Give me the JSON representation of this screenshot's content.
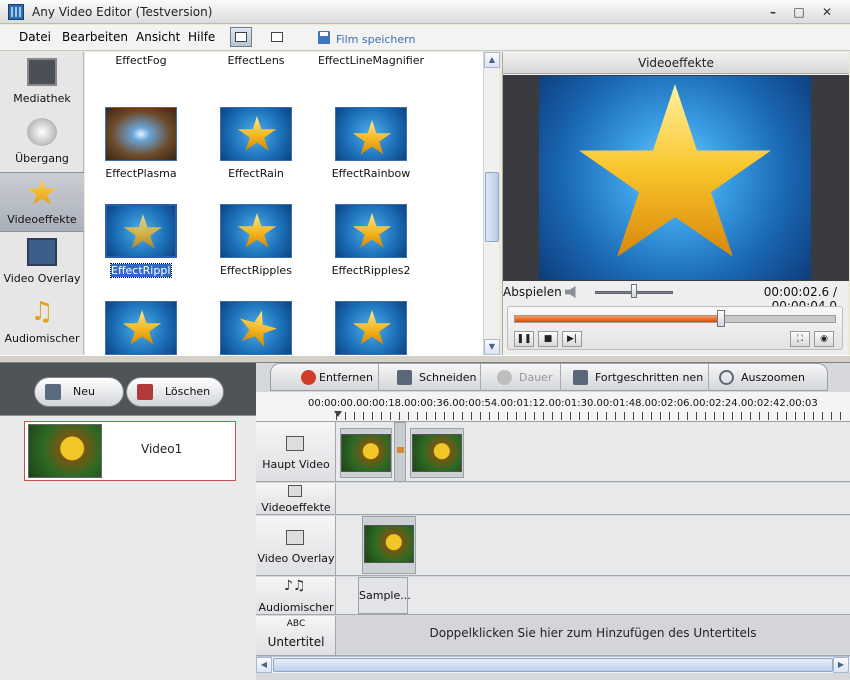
{
  "window": {
    "title": "Any Video Editor (Testversion)"
  },
  "menu": {
    "items": [
      "Datei",
      "Bearbeiten",
      "Ansicht",
      "Hilfe"
    ],
    "save_label": "Film speichern"
  },
  "categories": [
    {
      "label": "Mediathek",
      "icon": "film-icon"
    },
    {
      "label": "Übergang",
      "icon": "transition-icon"
    },
    {
      "label": "Videoeffekte",
      "icon": "effects-star-icon",
      "active": true
    },
    {
      "label": "Video Overlay",
      "icon": "overlay-icon"
    },
    {
      "label": "Audiomischer",
      "icon": "music-note-icon"
    }
  ],
  "effects": {
    "top_row": [
      "EffectFog",
      "EffectLens",
      "EffectLineMagnifier"
    ],
    "rows": [
      [
        "EffectPlasma",
        "EffectRain",
        "EffectRainbow"
      ],
      [
        "EffectRipple",
        "EffectRipples",
        "EffectRipples2"
      ]
    ],
    "selected": "EffectRipple"
  },
  "preview": {
    "title": "Videoeffekte",
    "play_label": "Abspielen",
    "time": "00:00:02.6 / 00:00:04.0",
    "progress_fraction": 0.65,
    "volume_fraction": 0.5
  },
  "media": {
    "new_label": "Neu",
    "delete_label": "Löschen",
    "items": [
      {
        "label": "Video1"
      }
    ]
  },
  "timeline": {
    "toolbar": {
      "remove": "Entfernen",
      "cut": "Schneiden",
      "duration": "Dauer",
      "advanced": "Fortgeschritten",
      "advanced_tail": "nen",
      "zoom_out": "Auszoomen"
    },
    "ruler": "00:00:00.00:00:18.00:00:36.00:00:54.00:01:12.00:01:30.00:01:48.00:02:06.00:02:24.00:02:42.00:03",
    "tracks": {
      "main_video": "Haupt Video",
      "video_effects": "Videoeffekte",
      "video_overlay": "Video Overlay",
      "audio_mixer": "Audiomischer",
      "subtitle_abc": "ABC",
      "subtitle": "Untertitel"
    },
    "audio_clip": "Sample...",
    "subtitle_hint": "Doppelklicken Sie hier zum Hinzufügen des Untertitels"
  }
}
